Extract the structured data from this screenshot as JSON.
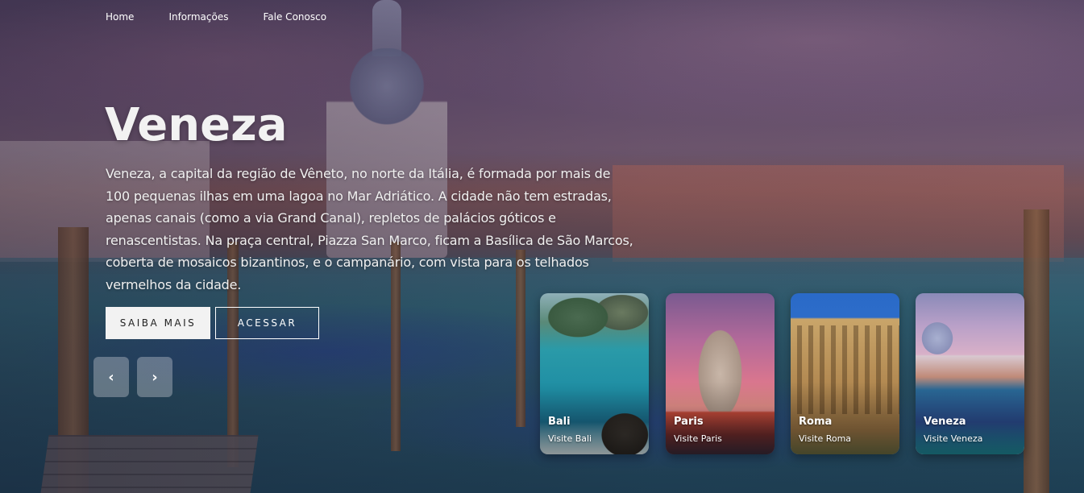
{
  "nav": {
    "items": [
      {
        "label": "Home"
      },
      {
        "label": "Informações"
      },
      {
        "label": "Fale Conosco"
      }
    ]
  },
  "hero": {
    "title": "Veneza",
    "description": "Veneza, a capital da região de Vêneto, no norte da Itália, é formada por mais de 100 pequenas ilhas em uma lagoa no Mar Adriático. A cidade não tem estradas, apenas canais (como a via Grand Canal), repletos de palácios góticos e renascentistas. Na praça central, Piazza San Marco, ficam a Basílica de São Marcos, coberta de mosaicos bizantinos, e o campanário, com vista para os telhados vermelhos da cidade.",
    "primary_button": "SAIBA MAIS",
    "secondary_button": "ACESSAR"
  },
  "carousel": {
    "prev_icon": "‹",
    "next_icon": "›",
    "cards": [
      {
        "name": "Bali",
        "subtitle": "Visite Bali"
      },
      {
        "name": "Paris",
        "subtitle": "Visite Paris"
      },
      {
        "name": "Roma",
        "subtitle": "Visite Roma"
      },
      {
        "name": "Veneza",
        "subtitle": "Visite Veneza"
      }
    ]
  },
  "colors": {
    "primary_button_bg": "#f2f2f2",
    "primary_button_text": "#222222",
    "text": "#ffffff"
  }
}
